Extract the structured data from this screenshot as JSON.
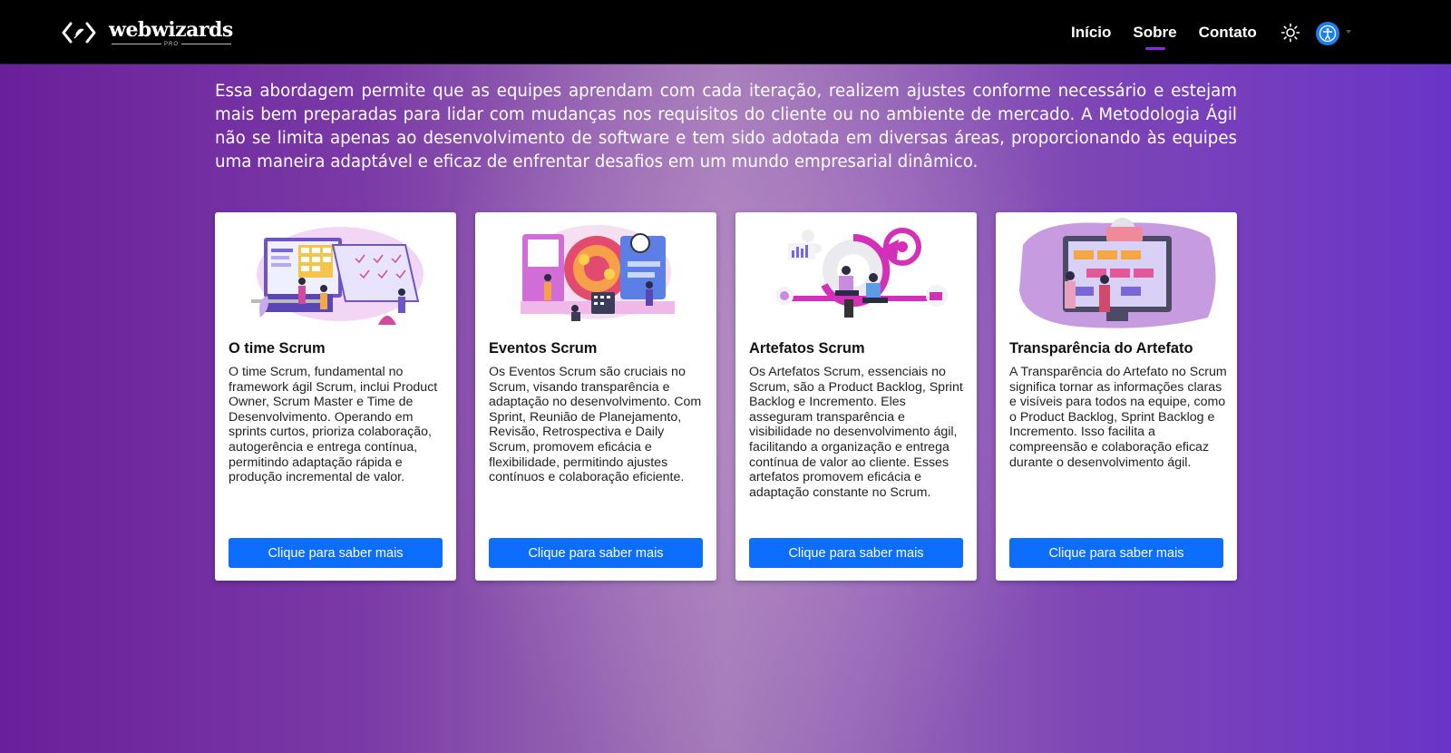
{
  "brand": {
    "name": "webwizards",
    "sub": "PRO"
  },
  "nav": {
    "items": [
      {
        "label": "Início"
      },
      {
        "label": "Sobre"
      },
      {
        "label": "Contato"
      }
    ]
  },
  "intro": {
    "text": "Essa abordagem permite que as equipes aprendam com cada iteração, realizem ajustes conforme necessário e estejam mais bem preparadas para lidar com mudanças nos requisitos do cliente ou no ambiente de mercado. A Metodologia Ágil não se limita apenas ao desenvolvimento de software e tem sido adotada em diversas áreas, proporcionando às equipes uma maneira adaptável e eficaz de enfrentar desafios em um mundo empresarial dinâmico."
  },
  "cards": [
    {
      "title": "O time Scrum",
      "text": "O time Scrum, fundamental no framework ágil Scrum, inclui Product Owner, Scrum Master e Time de Desenvolvimento. Operando em sprints curtos, prioriza colaboração, autogerência e entrega contínua, permitindo adaptação rápida e produção incremental de valor.",
      "button": "Clique para saber mais",
      "icon": "team-illustration"
    },
    {
      "title": "Eventos Scrum",
      "text": "Os Eventos Scrum são cruciais no Scrum, visando transparência e adaptação no desenvolvimento. Com Sprint, Reunião de Planejamento, Revisão, Retrospectiva e Daily Scrum, promovem eficácia e flexibilidade, permitindo ajustes contínuos e colaboração eficiente.",
      "button": "Clique para saber mais",
      "icon": "events-illustration"
    },
    {
      "title": "Artefatos Scrum",
      "text": "Os Artefatos Scrum, essenciais no Scrum, são a Product Backlog, Sprint Backlog e Incremento. Eles asseguram transparência e visibilidade no desenvolvimento ágil, facilitando a organização e entrega contínua de valor ao cliente. Esses artefatos promovem eficácia e adaptação constante no Scrum.",
      "button": "Clique para saber mais",
      "icon": "artifacts-illustration"
    },
    {
      "title": "Transparência do Artefato",
      "text": "A Transparência do Artefato no Scrum significa tornar as informações claras e visíveis para todos na equipe, como o Product Backlog, Sprint Backlog e Incremento. Isso facilita a compreensão e colaboração eficaz durante o desenvolvimento ágil.",
      "button": "Clique para saber mais",
      "icon": "transparency-illustration"
    }
  ],
  "colors": {
    "button": "#0d6efd",
    "navbar": "#000000",
    "accent": "#8a2be2",
    "accessibility": "#1d7ef0"
  }
}
